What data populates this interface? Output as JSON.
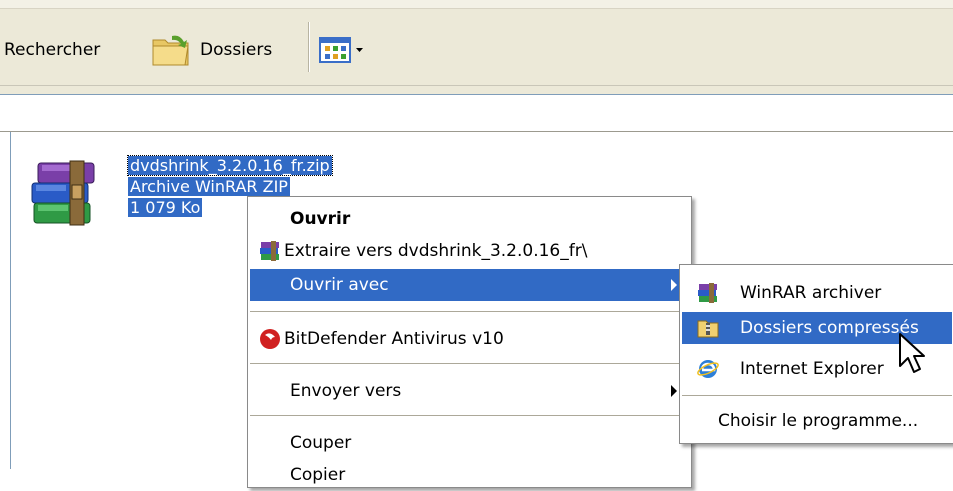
{
  "toolbar": {
    "search_label": "Rechercher",
    "folders_label": "Dossiers"
  },
  "file": {
    "name": "dvdshrink_3.2.0.16_fr.zip",
    "type": "Archive WinRAR ZIP",
    "size": "1 079 Ko"
  },
  "context_menu": {
    "open": "Ouvrir",
    "extract": "Extraire vers dvdshrink_3.2.0.16_fr\\",
    "open_with": "Ouvrir avec",
    "bitdefender": "BitDefender Antivirus v10",
    "send_to": "Envoyer vers",
    "cut": "Couper",
    "copy": "Copier"
  },
  "submenu": {
    "winrar": "WinRAR archiver",
    "compressed": "Dossiers compressés",
    "ie": "Internet Explorer",
    "choose": "Choisir le programme..."
  },
  "colors": {
    "selection": "#316ac5",
    "toolbar_bg": "#ece9d8"
  }
}
